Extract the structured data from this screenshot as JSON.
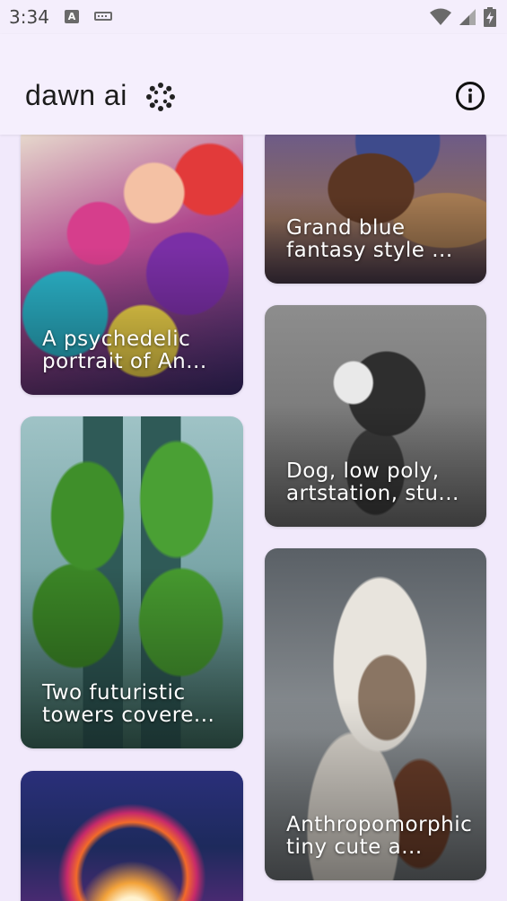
{
  "status_bar": {
    "time": "3:34",
    "notification_a_label": "A"
  },
  "header": {
    "brand": "dawn ai"
  },
  "cards": [
    {
      "caption": "A psychedelic portrait of An..."
    },
    {
      "caption": "Grand blue fantasy style ..."
    },
    {
      "caption": "Dog, low poly, artstation, stu..."
    },
    {
      "caption": "Two futuristic towers covere..."
    },
    {
      "caption": "Anthropomorphic tiny cute a..."
    },
    {
      "caption": ""
    }
  ],
  "colors": {
    "background": "#f1e9fb",
    "header": "#f5effd"
  }
}
